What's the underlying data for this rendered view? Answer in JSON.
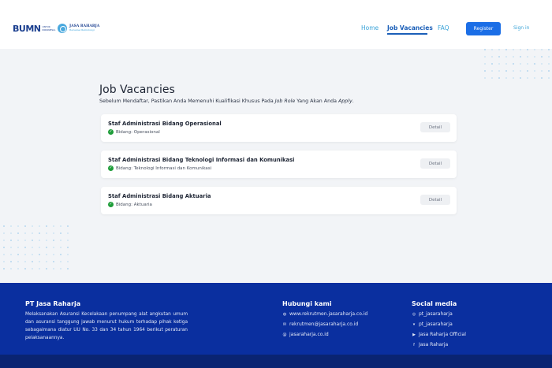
{
  "header": {
    "logo_bumn": {
      "text": "BUMN",
      "sub": "UNTUK INDONESIA"
    },
    "logo_jr": {
      "text": "JASA RAHARJA",
      "tag": "Bersama Melindungi"
    },
    "nav": {
      "home": "Home",
      "jobs": "Job Vacancies",
      "faq": "FAQ"
    },
    "register_label": "Register",
    "signin_label": "Sign in"
  },
  "main": {
    "title": "Job Vacancies",
    "subtitle_pre": "Sebelum Mendaftar, Pastikan Anda Memenuhi Kualifikasi Khusus Pada ",
    "subtitle_em1": "Job Role",
    "subtitle_mid": " Yang Akan Anda ",
    "subtitle_em2": "Apply",
    "subtitle_end": ".",
    "jobs": [
      {
        "title": "Staf Administrasi Bidang Operasional",
        "field": "Bidang: Operasional",
        "action": "Detail"
      },
      {
        "title": "Staf Administrasi Bidang Teknologi Informasi dan Komunikasi",
        "field": "Bidang: Teknologi Informasi dan Komunikasi",
        "action": "Detail"
      },
      {
        "title": "Staf Administrasi Bidang Aktuaria",
        "field": "Bidang: Aktuaria",
        "action": "Detail"
      }
    ]
  },
  "footer": {
    "company": "PT Jasa Raharja",
    "description": "Melaksanakan Asuransi Kecelakaan penumpang alat angkutan umum dan asuransi tanggung jawab menurut hukum terhadap pihak ketiga sebagaimana diatur UU No. 33 dan 34 tahun 1964 berikut peraturan pelaksanaannya.",
    "contact_title": "Hubungi kami",
    "contacts": [
      {
        "icon": "globe-icon",
        "text": "www.rekrutmen.jasaraharja.co.id"
      },
      {
        "icon": "mail-icon",
        "text": "rekrutmen@jasaraharja.co.id"
      },
      {
        "icon": "at-icon",
        "text": "jasaraharja.co.id"
      }
    ],
    "social_title": "Social media",
    "socials": [
      {
        "icon": "instagram-icon",
        "text": "pt_jasaraharja"
      },
      {
        "icon": "twitter-icon",
        "text": "pt_jasaraharja"
      },
      {
        "icon": "youtube-icon",
        "text": "Jasa Raharja Official"
      },
      {
        "icon": "facebook-icon",
        "text": "Jasa Raharja"
      }
    ]
  },
  "colors": {
    "brand_blue": "#1b6ee6",
    "footer_bg": "#0a2f9f",
    "accent_link": "#3aa3d8",
    "check_green": "#1f9d3a"
  }
}
